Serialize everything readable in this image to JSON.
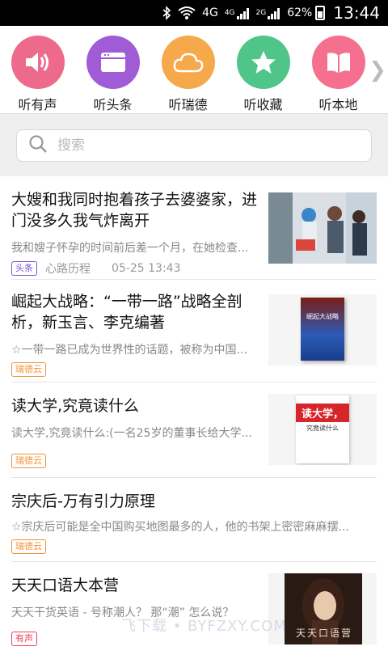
{
  "status": {
    "net1": "4G",
    "net2": "4G",
    "net3": "2G",
    "battery": "62%",
    "time": "13:44"
  },
  "quick_nav": [
    {
      "label": "听有声",
      "icon": "speaker-icon",
      "color": "#ee6a8c"
    },
    {
      "label": "听头条",
      "icon": "browser-window-icon",
      "color": "#a05bd6"
    },
    {
      "label": "听瑞德",
      "icon": "cloud-icon",
      "color": "#f5a94a"
    },
    {
      "label": "听收藏",
      "icon": "star-icon",
      "color": "#4fc58a"
    },
    {
      "label": "听本地",
      "icon": "book-icon",
      "color": "#f4708e"
    }
  ],
  "search": {
    "placeholder": "搜索"
  },
  "feed": [
    {
      "title": "大嫂和我同时抱着孩子去婆婆家，进门没多久我气炸离开",
      "desc": "我和嫂子怀孕的时间前后差一个月，在她检查...",
      "tag": "头条",
      "tag_color": "#7a55d6",
      "source": "心路历程",
      "time": "05-25 13:43"
    },
    {
      "title": "崛起大战略：“一带一路”战略全剖析，新玉言、李克编著",
      "desc": "☆一带一路已成为世界性的话题，被称为中国...",
      "tag": "瑞德云",
      "tag_color": "#f0913a"
    },
    {
      "title": "读大学,究竟读什么",
      "desc": "读大学,究竟读什么:(一名25岁的董事长给大学...",
      "tag": "瑞德云",
      "tag_color": "#f0913a"
    },
    {
      "title": "宗庆后-万有引力原理",
      "desc": "☆宗庆后可能是全中国购买地图最多的人，他的书架上密密麻麻摆...",
      "tag": "瑞德云",
      "tag_color": "#f0913a"
    },
    {
      "title": "天天口语大本营",
      "desc": "天天干货英语 - 号称潮人？ 那“潮” 怎么说？",
      "tag": "有声",
      "tag_color": "#e0445e"
    }
  ],
  "thumbs": {
    "book1_title": "崛起大战略",
    "book2_title": "读大学，",
    "book2_sub": "究竟读什么",
    "cover5_text": "天天口语营"
  },
  "watermark": "飞下载 • BYFZXY.COM"
}
